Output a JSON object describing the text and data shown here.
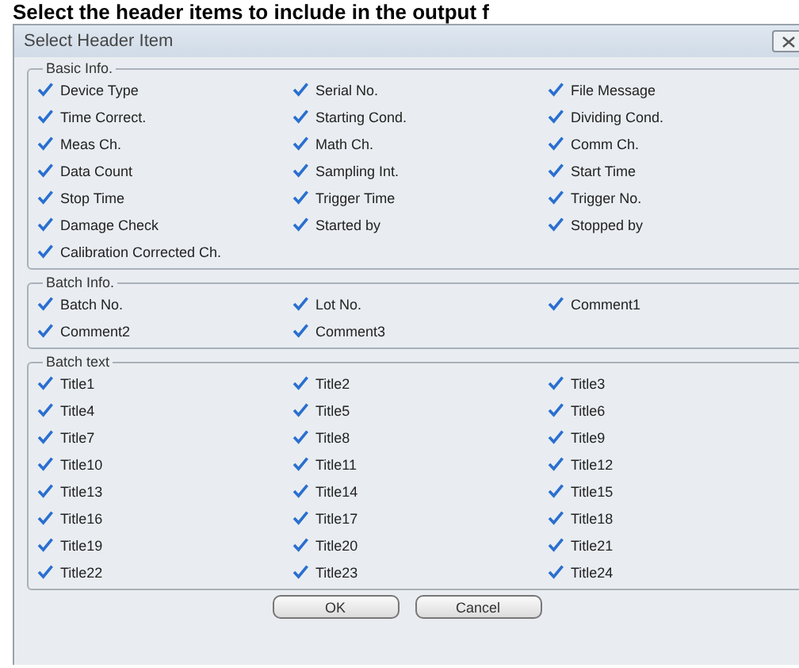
{
  "caption": "Select the header items to include in the output f",
  "window": {
    "title": "Select Header Item"
  },
  "groups": [
    {
      "label": "Basic Info.",
      "items": [
        {
          "label": "Device Type",
          "checked": true
        },
        {
          "label": "Serial No.",
          "checked": true
        },
        {
          "label": "File Message",
          "checked": true
        },
        {
          "label": "Time Correct.",
          "checked": true
        },
        {
          "label": "Starting Cond.",
          "checked": true
        },
        {
          "label": "Dividing Cond.",
          "checked": true
        },
        {
          "label": "Meas Ch.",
          "checked": true
        },
        {
          "label": "Math Ch.",
          "checked": true
        },
        {
          "label": "Comm Ch.",
          "checked": true
        },
        {
          "label": "Data Count",
          "checked": true
        },
        {
          "label": "Sampling Int.",
          "checked": true
        },
        {
          "label": "Start Time",
          "checked": true
        },
        {
          "label": "Stop Time",
          "checked": true
        },
        {
          "label": "Trigger Time",
          "checked": true
        },
        {
          "label": "Trigger No.",
          "checked": true
        },
        {
          "label": "Damage Check",
          "checked": true
        },
        {
          "label": "Started by",
          "checked": true
        },
        {
          "label": "Stopped by",
          "checked": true
        },
        {
          "label": "Calibration Corrected Ch.",
          "checked": true
        }
      ]
    },
    {
      "label": "Batch Info.",
      "items": [
        {
          "label": "Batch No.",
          "checked": true
        },
        {
          "label": "Lot No.",
          "checked": true
        },
        {
          "label": "Comment1",
          "checked": true
        },
        {
          "label": "Comment2",
          "checked": true
        },
        {
          "label": "Comment3",
          "checked": true
        }
      ]
    },
    {
      "label": "Batch text",
      "items": [
        {
          "label": "Title1",
          "checked": true
        },
        {
          "label": "Title2",
          "checked": true
        },
        {
          "label": "Title3",
          "checked": true
        },
        {
          "label": "Title4",
          "checked": true
        },
        {
          "label": "Title5",
          "checked": true
        },
        {
          "label": "Title6",
          "checked": true
        },
        {
          "label": "Title7",
          "checked": true
        },
        {
          "label": "Title8",
          "checked": true
        },
        {
          "label": "Title9",
          "checked": true
        },
        {
          "label": "Title10",
          "checked": true
        },
        {
          "label": "Title11",
          "checked": true
        },
        {
          "label": "Title12",
          "checked": true
        },
        {
          "label": "Title13",
          "checked": true
        },
        {
          "label": "Title14",
          "checked": true
        },
        {
          "label": "Title15",
          "checked": true
        },
        {
          "label": "Title16",
          "checked": true
        },
        {
          "label": "Title17",
          "checked": true
        },
        {
          "label": "Title18",
          "checked": true
        },
        {
          "label": "Title19",
          "checked": true
        },
        {
          "label": "Title20",
          "checked": true
        },
        {
          "label": "Title21",
          "checked": true
        },
        {
          "label": "Title22",
          "checked": true
        },
        {
          "label": "Title23",
          "checked": true
        },
        {
          "label": "Title24",
          "checked": true
        }
      ]
    }
  ],
  "buttons": [
    "OK",
    "Cancel"
  ]
}
